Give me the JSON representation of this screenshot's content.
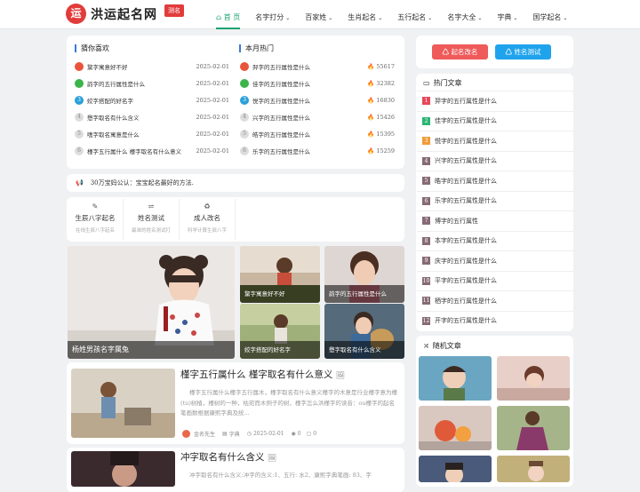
{
  "site": {
    "logo_char": "运",
    "name": "洪运起名网",
    "tag": "测名"
  },
  "nav": [
    {
      "icon": "⌂",
      "label": "首 页",
      "active": true
    },
    {
      "label": "名字打分",
      "chev": "⌄"
    },
    {
      "label": "百家姓",
      "chev": "⌄"
    },
    {
      "label": "生肖起名",
      "chev": "⌄"
    },
    {
      "label": "五行起名",
      "chev": "⌄"
    },
    {
      "label": "名字大全",
      "chev": "⌄"
    },
    {
      "label": "字典",
      "chev": "⌄"
    },
    {
      "label": "国学起名",
      "chev": "⌄"
    }
  ],
  "guess": {
    "title": "猜你喜欢",
    "items": [
      {
        "n": "",
        "title": "黧字寓意好不好",
        "date": "2025-02-01",
        "color": "#e9543a"
      },
      {
        "n": "",
        "title": "韵字的五行属性是什么",
        "date": "2025-02-01",
        "color": "#3bb54a"
      },
      {
        "n": "3",
        "title": "姣字搭配的好名字",
        "date": "2025-02-01",
        "color": "#2aa0d8"
      },
      {
        "n": "4",
        "title": "懋字取名有什么含义",
        "date": "2025-02-01",
        "color": "#ddd"
      },
      {
        "n": "5",
        "title": "嗜字取名寓意是什么",
        "date": "2025-02-01",
        "color": "#ddd"
      },
      {
        "n": "6",
        "title": "槿字五行属什么 槿字取名有什么意义",
        "date": "2025-02-01",
        "color": "#ddd"
      }
    ]
  },
  "hot": {
    "title": "本月热门",
    "items": [
      {
        "n": "",
        "title": "羿字的五行属性是什么",
        "count": "55617",
        "color": "#e9543a"
      },
      {
        "n": "",
        "title": "佳字的五行属性是什么",
        "count": "32382",
        "color": "#3bb54a"
      },
      {
        "n": "3",
        "title": "悦字的五行属性是什么",
        "count": "16830",
        "color": "#2aa0d8"
      },
      {
        "n": "4",
        "title": "兴字的五行属性是什么",
        "count": "15426",
        "color": "#ddd"
      },
      {
        "n": "5",
        "title": "皓字的五行属性是什么",
        "count": "15395",
        "color": "#ddd"
      },
      {
        "n": "6",
        "title": "乐字的五行属性是什么",
        "count": "15259",
        "color": "#ddd"
      }
    ]
  },
  "notice": {
    "icon": "📢",
    "text": "30万宝妈公认：宝宝起名最好的方法."
  },
  "quick": [
    {
      "icon": "✎",
      "title": "生辰八字起名",
      "sub": "在线生辰八字起名"
    },
    {
      "icon": "⇌",
      "title": "姓名测试",
      "sub": "最准的姓名测试打"
    },
    {
      "icon": "♻",
      "title": "成人改名",
      "sub": "科学计算生辰八字"
    }
  ],
  "gallery": {
    "main": "杨姓男孩名字属兔",
    "tiles": [
      "黧字寓意好不好",
      "韵字的五行属性是什么",
      "姣字搭配的好名字",
      "懋字取名有什么含义"
    ]
  },
  "articles": [
    {
      "title": "槿字五行属什么 槿字取名有什么意义",
      "excerpt": "槿字五行属什么槿字五行属木，槿字取名有什么意义槿字的木意是行业槿字意为槿(tu)树植，槿树的一种，枯宛而木例子的树，槿字怎么洪槿字的读音：ou槿字的起名笔画数根据康熙字典及统...",
      "author": "金名先生",
      "cat": "字典",
      "date": "2025-02-01",
      "views": "0",
      "comments": "0"
    },
    {
      "title": "冲字取名有什么含义",
      "excerpt": "冲字取名有什么含义:冲字的含义:1、五行: 水2、康熙字典笔画: 83、字",
      "author": "",
      "cat": "",
      "date": "",
      "views": "",
      "comments": ""
    }
  ],
  "side_buttons": [
    {
      "icon": "♺",
      "label": "起名改名",
      "color": "#ef5a5a"
    },
    {
      "icon": "♺",
      "label": "姓名测试",
      "color": "#1fa3ec"
    }
  ],
  "hot_articles": {
    "icon": "▭",
    "title": "热门文章",
    "items": [
      {
        "n": "1",
        "title": "羿字的五行属性是什么",
        "color": "#e8475a"
      },
      {
        "n": "2",
        "title": "佳字的五行属性是什么",
        "color": "#2bb673"
      },
      {
        "n": "3",
        "title": "悦字的五行属性是什么",
        "color": "#f29c38"
      },
      {
        "n": "4",
        "title": "兴字的五行属性是什么",
        "color": "#866a75"
      },
      {
        "n": "5",
        "title": "皓字的五行属性是什么",
        "color": "#866a75"
      },
      {
        "n": "6",
        "title": "乐字的五行属性是什么",
        "color": "#866a75"
      },
      {
        "n": "7",
        "title": "博字的五行属性",
        "color": "#866a75"
      },
      {
        "n": "8",
        "title": "本字的五行属性是什么",
        "color": "#866a75"
      },
      {
        "n": "9",
        "title": "庆字的五行属性是什么",
        "color": "#866a75"
      },
      {
        "n": "10",
        "title": "平字的五行属性是什么",
        "color": "#866a75"
      },
      {
        "n": "11",
        "title": "栖字的五行属性是什么",
        "color": "#866a75"
      },
      {
        "n": "12",
        "title": "开字的五行属性是什么",
        "color": "#866a75"
      }
    ]
  },
  "random": {
    "icon": "⤮",
    "title": "随机文章"
  }
}
